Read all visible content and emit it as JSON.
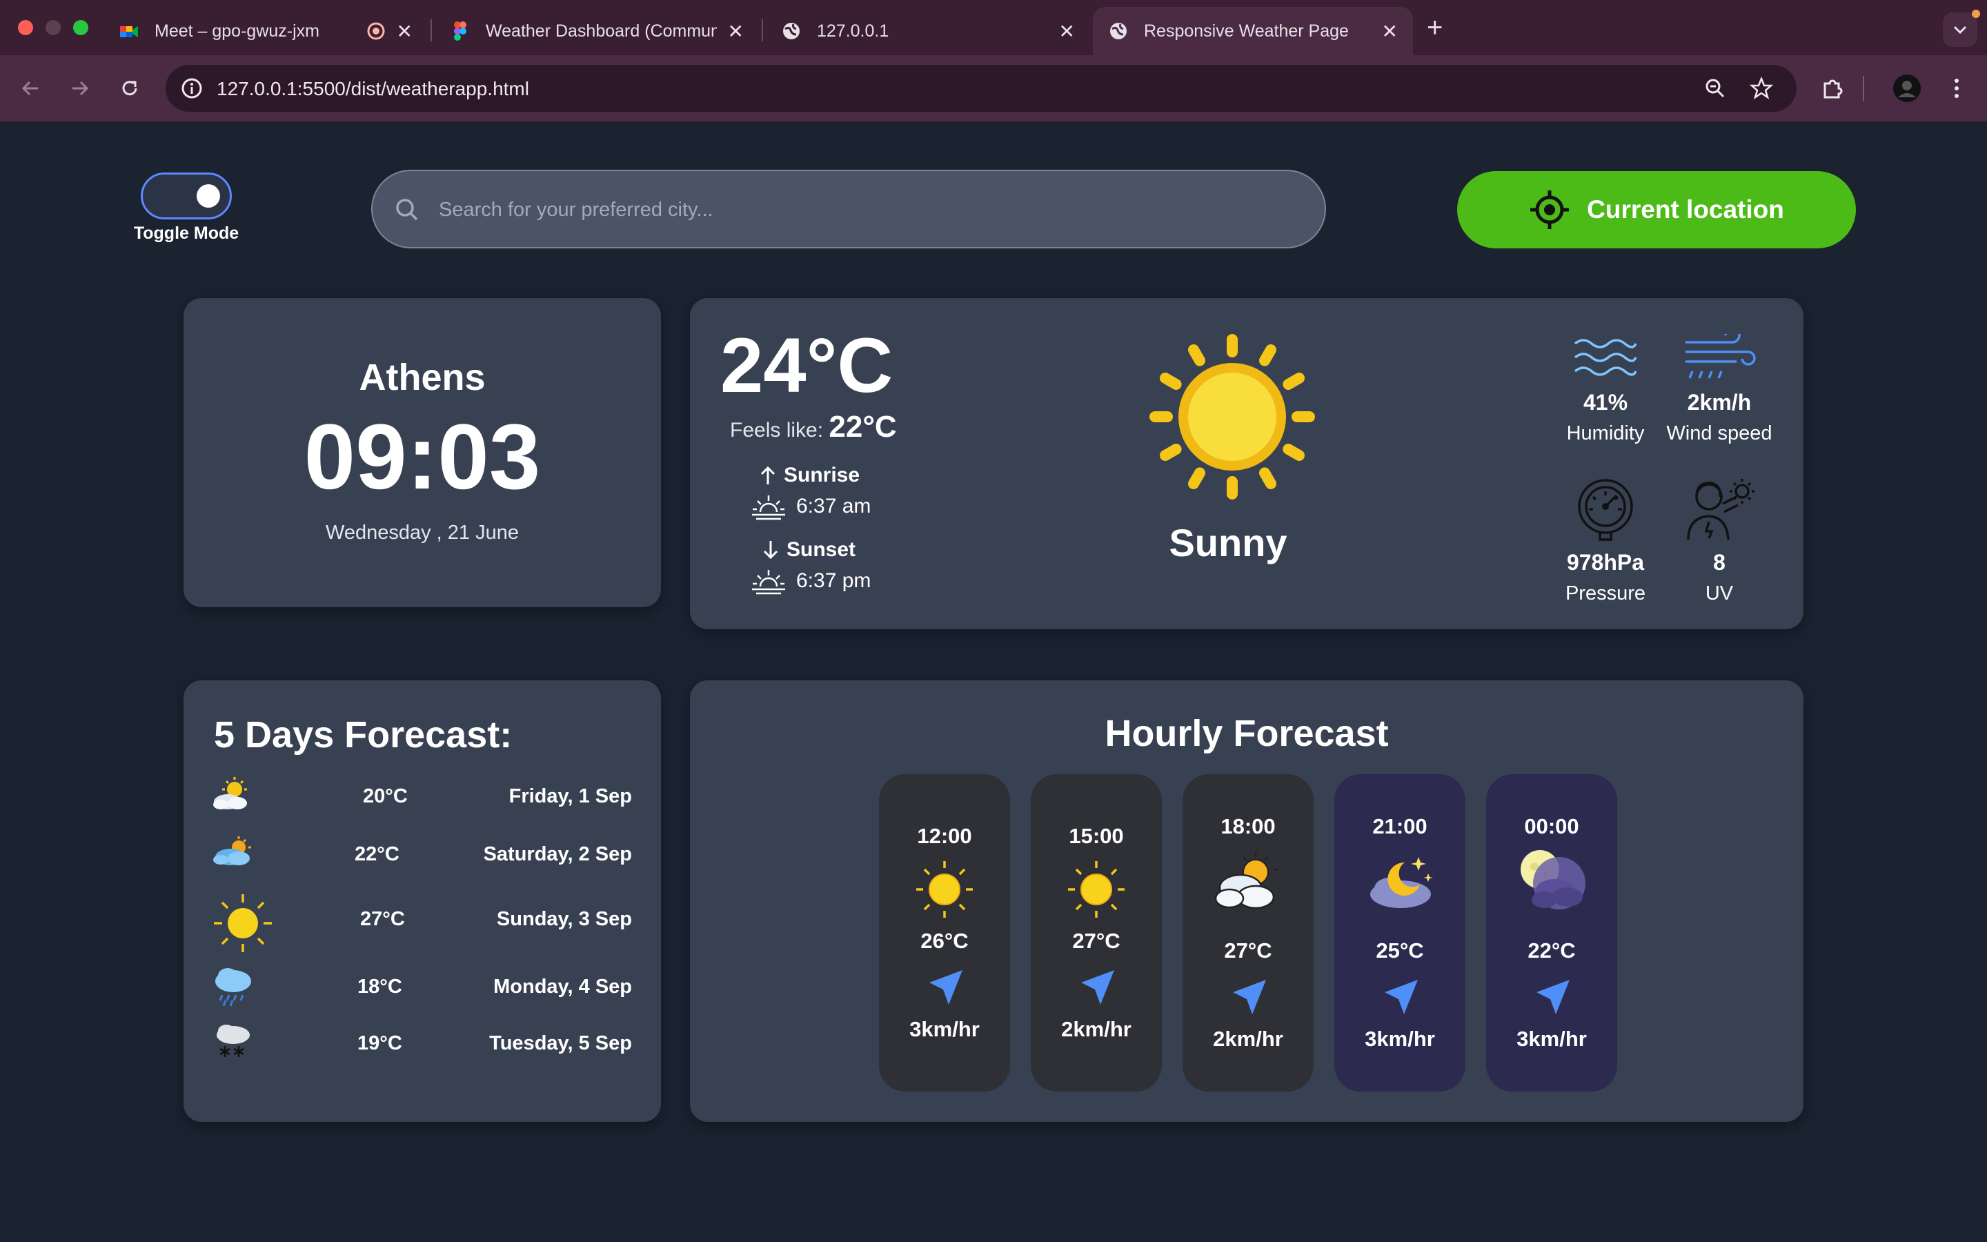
{
  "browser": {
    "tabs": [
      {
        "title": "Meet – gpo-gwuz-jxm",
        "favicon": "google-meet-icon"
      },
      {
        "title": "Weather Dashboard (Community)",
        "favicon": "figma-icon"
      },
      {
        "title": "127.0.0.1",
        "favicon": "globe-icon"
      },
      {
        "title": "Responsive Weather Page",
        "favicon": "globe-icon",
        "active": true
      }
    ],
    "url": "127.0.0.1:5500/dist/weatherapp.html"
  },
  "app": {
    "toggle_label": "Toggle Mode",
    "search_placeholder": "Search for your preferred city...",
    "location_button": "Current location",
    "city": "Athens",
    "time": "09:03",
    "date": "Wednesday , 21 June",
    "current": {
      "temperature": "24°C",
      "feels_label": "Feels like:",
      "feels_value": "22°C",
      "sunrise_label": "Sunrise",
      "sunrise_time": "6:37 am",
      "sunset_label": "Sunset",
      "sunset_time": "6:37 pm",
      "condition": "Sunny",
      "humidity_value": "41%",
      "humidity_label": "Humidity",
      "wind_value": "2km/h",
      "wind_label": "Wind speed",
      "pressure_value": "978hPa",
      "pressure_label": "Pressure",
      "uv_value": "8",
      "uv_label": "UV"
    },
    "forecast_title": "5 Days Forecast:",
    "forecast": [
      {
        "temp": "20°C",
        "day": "Friday, 1 Sep",
        "icon": "partly-cloudy-icon"
      },
      {
        "temp": "22°C",
        "day": "Saturday, 2 Sep",
        "icon": "cloud-sun-icon"
      },
      {
        "temp": "27°C",
        "day": "Sunday, 3 Sep",
        "icon": "sun-icon"
      },
      {
        "temp": "18°C",
        "day": "Monday, 4 Sep",
        "icon": "rain-icon"
      },
      {
        "temp": "19°C",
        "day": "Tuesday, 5 Sep",
        "icon": "snow-icon"
      }
    ],
    "hourly_title": "Hourly Forecast",
    "hourly": [
      {
        "time": "12:00",
        "temp": "26°C",
        "wind": "3km/hr",
        "icon": "sun-icon"
      },
      {
        "time": "15:00",
        "temp": "27°C",
        "wind": "2km/hr",
        "icon": "sun-icon"
      },
      {
        "time": "18:00",
        "temp": "27°C",
        "wind": "2km/hr",
        "icon": "sun-behind-clouds-icon"
      },
      {
        "time": "21:00",
        "temp": "25°C",
        "wind": "3km/hr",
        "icon": "moon-cloud-icon"
      },
      {
        "time": "00:00",
        "temp": "22°C",
        "wind": "3km/hr",
        "icon": "full-moon-clouds-icon"
      }
    ]
  },
  "colors": {
    "background": "#1b2230",
    "card": "#384152",
    "accent_green": "#4cbb17",
    "sun_yellow": "#f5d33a",
    "wind_arrow": "#4f8ff7"
  }
}
